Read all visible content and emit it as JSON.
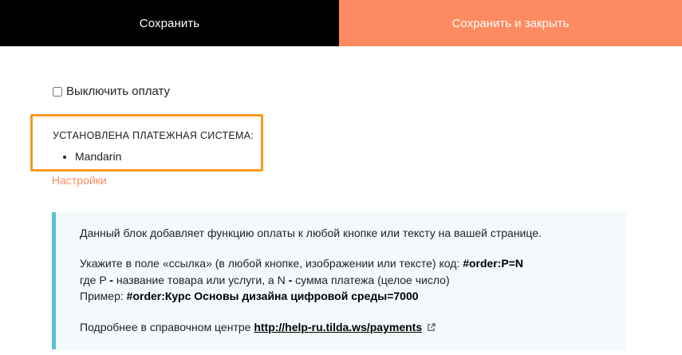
{
  "toolbar": {
    "save_label": "Сохранить",
    "save_close_label": "Сохранить и закрыть"
  },
  "payment": {
    "disable_label": "Выключить оплату",
    "disable_checked": false,
    "heading": "УСТАНОВЛЕНА ПЛАТЕЖНАЯ СИСТЕМА:",
    "systems": [
      "Mandarin"
    ],
    "settings_link": "Настройки"
  },
  "info": {
    "line1": "Данный блок добавляет функцию оплаты к любой кнопке или тексту на вашей странице.",
    "line2_text": "Укажите в поле «ссылка» (в любой кнопке, изображении или тексте) код: ",
    "line2_code": "#order:P=N",
    "line3_a": "где P ",
    "line3_b": "- ",
    "line3_c": "название товара или услуги, а N ",
    "line3_d": "- ",
    "line3_e": "сумма платежа (целое число)",
    "line4_label": "Пример: ",
    "line4_code": "#order:Курс Основы дизайна цифровой среды=7000",
    "line5_text": "Подробнее в справочном центре ",
    "help_link": "http://help-ru.tilda.ws/payments",
    "external_icon": "external-link-icon"
  },
  "colors": {
    "save_bg": "#000000",
    "save_close_bg": "#fe8a61",
    "highlight_border": "#f79a1e",
    "info_border": "#58c1d3",
    "info_bg": "#f4f9fc",
    "link": "#fe8a61"
  }
}
